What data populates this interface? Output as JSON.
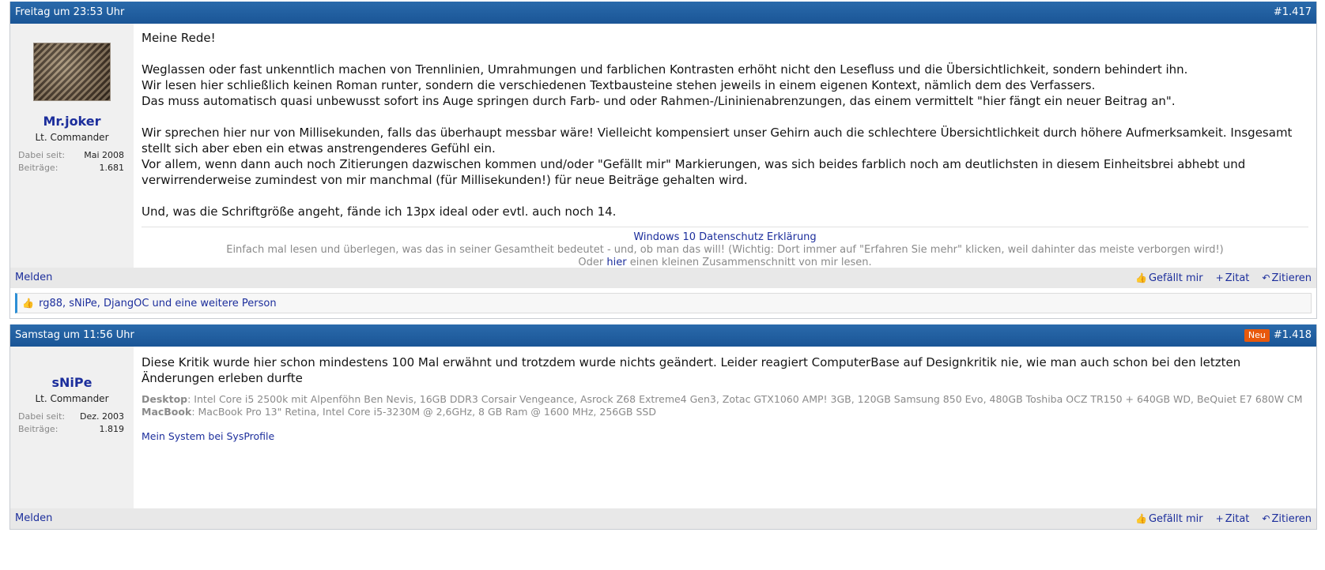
{
  "posts": [
    {
      "date": "Freitag um 23:53 Uhr",
      "number": "#1.417",
      "badge": "",
      "user": {
        "name": "Mr.joker",
        "title": "Lt. Commander",
        "joined_label": "Dabei seit:",
        "joined": "Mai 2008",
        "posts_label": "Beiträge:",
        "posts": "1.681"
      },
      "paragraphs": [
        "Meine Rede!",
        "Weglassen oder fast unkenntlich machen von Trennlinien, Umrahmungen und farblichen Kontrasten erhöht nicht den Lesefluss und die Übersichtlichkeit, sondern behindert ihn.",
        "Wir lesen hier schließlich keinen Roman runter, sondern die verschiedenen Textbausteine stehen jeweils in einem eigenen Kontext, nämlich dem des Verfassers.",
        "Das muss automatisch quasi unbewusst sofort ins Auge springen durch Farb- und oder Rahmen-/Lininienabrenzungen, das einem vermittelt \"hier fängt ein neuer Beitrag an\".",
        "Wir sprechen hier nur von Millisekunden, falls das überhaupt messbar wäre! Vielleicht kompensiert unser Gehirn auch die schlechtere Übersichtlichkeit durch höhere Aufmerksamkeit. Insgesamt stellt sich aber eben ein etwas anstrengenderes Gefühl ein.",
        "Vor allem, wenn dann auch noch Zitierungen dazwischen kommen und/oder \"Gefällt mir\" Markierungen, was sich beides farblich noch am deutlichsten in diesem Einheitsbrei abhebt und verwirrenderweise zumindest von mir manchmal (für Millisekunden!) für neue Beiträge gehalten wird.",
        "Und, was die Schriftgröße angeht, fände ich 13px ideal oder evtl. auch noch 14."
      ],
      "signature": {
        "link": "Windows 10 Datenschutz Erklärung",
        "line2": "Einfach mal lesen und überlegen, was das in seiner Gesamtheit bedeutet - und, ob man das will! (Wichtig: Dort immer auf \"Erfahren Sie mehr\" klicken, weil dahinter das meiste verborgen wird!)",
        "line3_pre": "Oder",
        "line3_link": "hier",
        "line3_post": "einen kleinen Zusammenschnitt von mir lesen."
      },
      "likes_text": "rg88, sNiPe, DjangOC und eine weitere Person"
    },
    {
      "date": "Samstag um 11:56 Uhr",
      "number": "#1.418",
      "badge": "Neu",
      "user": {
        "name": "sNiPe",
        "title": "Lt. Commander",
        "joined_label": "Dabei seit:",
        "joined": "Dez. 2003",
        "posts_label": "Beiträge:",
        "posts": "1.819"
      },
      "paragraphs": [
        "Diese Kritik wurde hier schon mindestens 100 Mal erwähnt und trotzdem wurde nichts geändert. Leider reagiert ComputerBase auf Designkritik nie, wie man auch schon bei den letzten Änderungen erleben durfte"
      ],
      "specs": {
        "desktop_label": "Desktop",
        "desktop": ": Intel Core i5 2500k mit Alpenföhn Ben Nevis, 16GB DDR3 Corsair Vengeance, Asrock Z68 Extreme4 Gen3, Zotac GTX1060 AMP! 3GB, 120GB Samsung 850 Evo, 480GB Toshiba OCZ TR150 + 640GB WD, BeQuiet E7 680W CM",
        "macbook_label": "MacBook",
        "macbook": ": MacBook Pro 13\" Retina, Intel Core i5-3230M @ 2,6GHz, 8 GB Ram @ 1600 MHz, 256GB SSD",
        "sysprofile": "Mein System bei SysProfile"
      }
    }
  ],
  "footer": {
    "report": "Melden",
    "like": "Gefällt mir",
    "quote": "Zitat",
    "reply": "Zitieren"
  }
}
